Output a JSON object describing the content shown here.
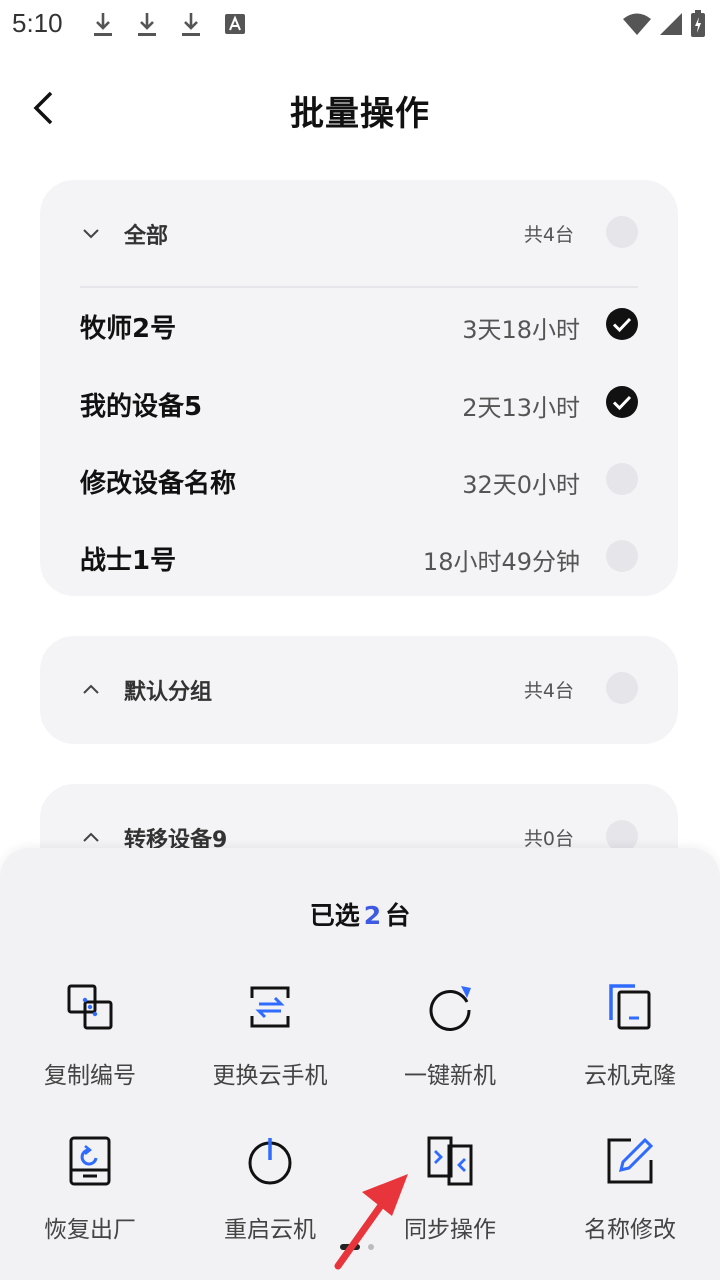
{
  "status_bar": {
    "time": "5:10",
    "icons_left": [
      "download-icon",
      "download-icon",
      "download-icon",
      "font-app-icon"
    ],
    "icons_right": [
      "wifi-icon",
      "signal-icon",
      "battery-charging-icon"
    ]
  },
  "header": {
    "title": "批量操作",
    "back_icon": "chevron-left-icon"
  },
  "groups": [
    {
      "name": "全部",
      "count": "共4台",
      "expanded": true,
      "devices": [
        {
          "name": "牧师2号",
          "time": "3天18小时",
          "selected": true
        },
        {
          "name": "我的设备5",
          "time": "2天13小时",
          "selected": true
        },
        {
          "name": "修改设备名称",
          "time": "32天0小时",
          "selected": false
        },
        {
          "name": "战士1号",
          "time": "18小时49分钟",
          "selected": false
        }
      ]
    },
    {
      "name": "默认分组",
      "count": "共4台",
      "expanded": false
    },
    {
      "name": "转移设备9",
      "count": "共0台",
      "expanded": false
    }
  ],
  "sheet": {
    "title_prefix": "已选",
    "selected_count": "2",
    "title_suffix": "台",
    "accent_color": "#3d5ae0",
    "actions": [
      {
        "label": "复制编号",
        "icon": "copy-id-icon"
      },
      {
        "label": "更换云手机",
        "icon": "swap-phone-icon"
      },
      {
        "label": "一键新机",
        "icon": "refresh-icon"
      },
      {
        "label": "云机克隆",
        "icon": "clone-icon"
      },
      {
        "label": "恢复出厂",
        "icon": "factory-reset-icon"
      },
      {
        "label": "重启云机",
        "icon": "power-icon"
      },
      {
        "label": "同步操作",
        "icon": "sync-operation-icon"
      },
      {
        "label": "名称修改",
        "icon": "edit-name-icon"
      }
    ],
    "page_indicator": {
      "current": 1,
      "total": 2
    }
  }
}
